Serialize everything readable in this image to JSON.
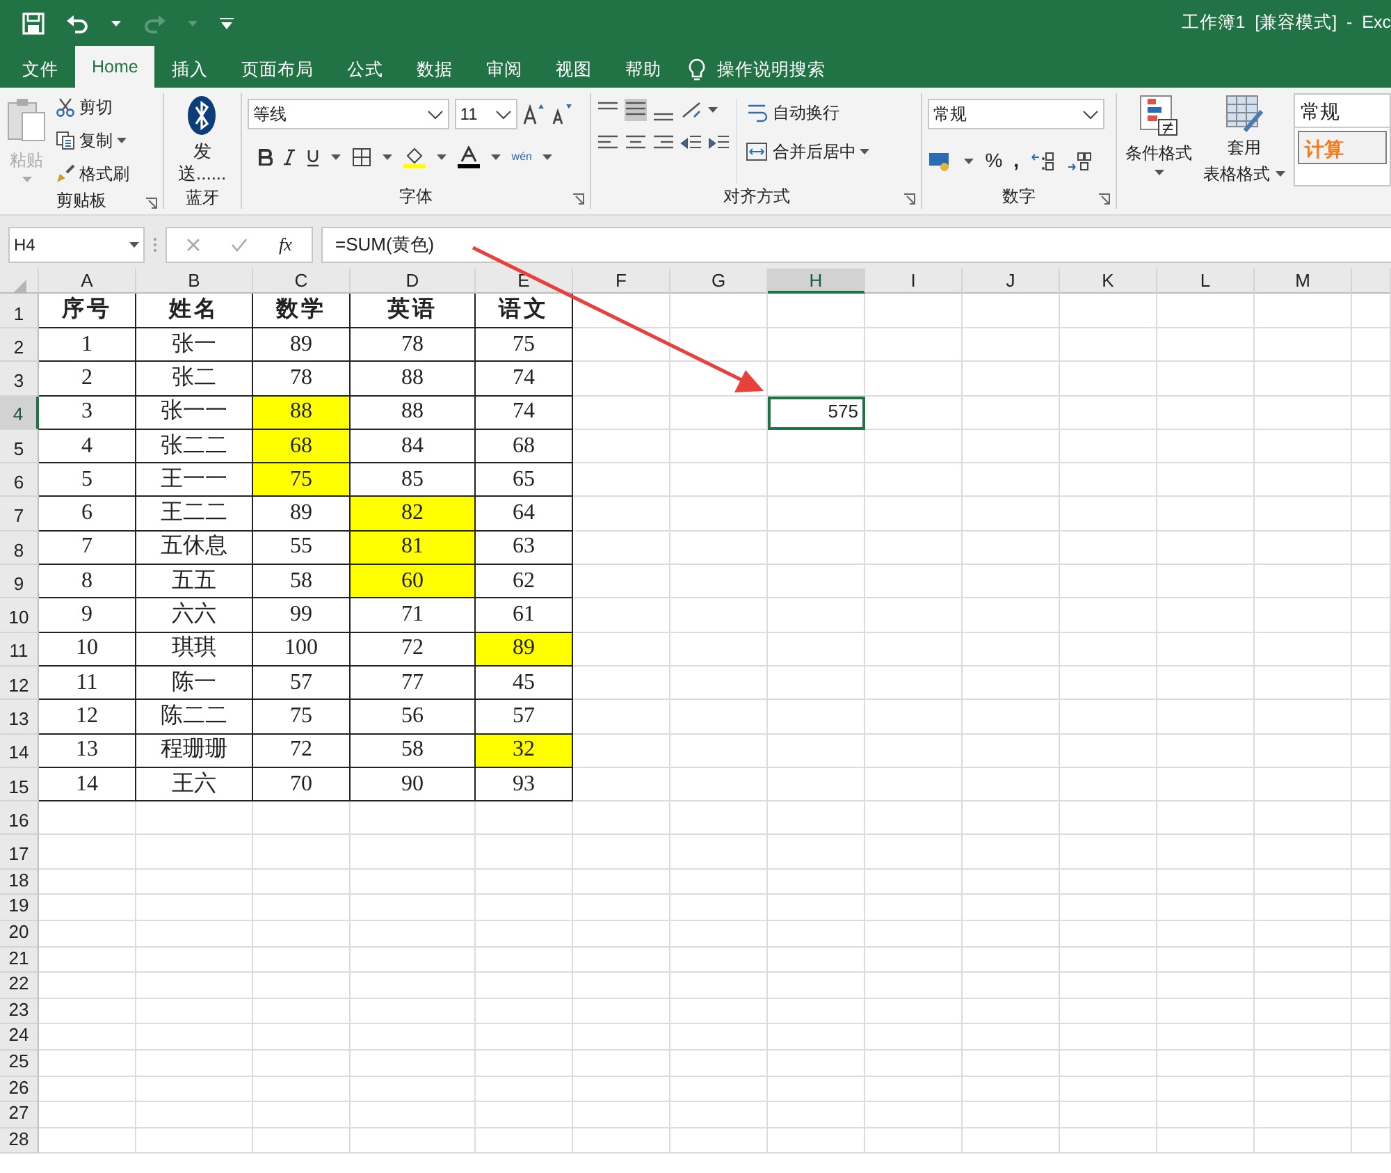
{
  "quick_access": {
    "redo_disabled": true
  },
  "window": {
    "title": "工作簿1  [兼容模式]  -  Exc"
  },
  "tabs": [
    {
      "label": "文件",
      "selected": false
    },
    {
      "label": "Home",
      "selected": true
    },
    {
      "label": "插入",
      "selected": false
    },
    {
      "label": "页面布局",
      "selected": false
    },
    {
      "label": "公式",
      "selected": false
    },
    {
      "label": "数据",
      "selected": false
    },
    {
      "label": "审阅",
      "selected": false
    },
    {
      "label": "视图",
      "selected": false
    },
    {
      "label": "帮助",
      "selected": false
    }
  ],
  "tell_me": {
    "label": "操作说明搜索"
  },
  "ribbon": {
    "clipboard": {
      "label": "剪贴板",
      "paste": {
        "text": "粘贴",
        "disabled": true
      },
      "cut": "剪切",
      "copy": "复制",
      "format_painter": "格式刷"
    },
    "bluetooth": {
      "label": "蓝牙",
      "send": "发送......"
    },
    "font": {
      "label": "字体",
      "font_name": "等线",
      "font_size": "11",
      "phonetic": "wén"
    },
    "alignment": {
      "label": "对齐方式",
      "wrap_text": "自动换行",
      "merge_center": "合并后居中"
    },
    "number": {
      "label": "数字",
      "format": "常规",
      "percent": "%",
      "comma": ","
    },
    "styles": {
      "conditional_formatting": "条件格式",
      "format_as_table_1": "套用",
      "format_as_table_2": "表格格式",
      "style_normal": "常规",
      "style_calculation": "计算"
    }
  },
  "formula_bar": {
    "name_box": "H4",
    "fx": "fx",
    "formula": "=SUM(黄色)"
  },
  "sheet": {
    "columns": [
      {
        "label": "A",
        "selected": false
      },
      {
        "label": "B",
        "selected": false
      },
      {
        "label": "C",
        "selected": false
      },
      {
        "label": "D",
        "selected": false
      },
      {
        "label": "E",
        "selected": false
      },
      {
        "label": "F",
        "selected": false
      },
      {
        "label": "G",
        "selected": false
      },
      {
        "label": "H",
        "selected": true
      },
      {
        "label": "I",
        "selected": false
      },
      {
        "label": "J",
        "selected": false
      },
      {
        "label": "K",
        "selected": false
      },
      {
        "label": "L",
        "selected": false
      },
      {
        "label": "M",
        "selected": false
      }
    ],
    "rows": [
      {
        "header": "1",
        "selected": false,
        "cells": [
          {
            "text": "序号",
            "highlighted": false
          },
          {
            "text": "姓名",
            "highlighted": false
          },
          {
            "text": "数学",
            "highlighted": false
          },
          {
            "text": "英语",
            "highlighted": false
          },
          {
            "text": "语文",
            "highlighted": false
          }
        ]
      },
      {
        "header": "2",
        "selected": false,
        "cells": [
          {
            "text": "1",
            "highlighted": false
          },
          {
            "text": "张一",
            "highlighted": false
          },
          {
            "text": "89",
            "highlighted": false
          },
          {
            "text": "78",
            "highlighted": false
          },
          {
            "text": "75",
            "highlighted": false
          }
        ]
      },
      {
        "header": "3",
        "selected": false,
        "cells": [
          {
            "text": "2",
            "highlighted": false
          },
          {
            "text": "张二",
            "highlighted": false
          },
          {
            "text": "78",
            "highlighted": false
          },
          {
            "text": "88",
            "highlighted": false
          },
          {
            "text": "74",
            "highlighted": false
          }
        ]
      },
      {
        "header": "4",
        "selected": true,
        "cells": [
          {
            "text": "3",
            "highlighted": false
          },
          {
            "text": "张一一",
            "highlighted": false
          },
          {
            "text": "88",
            "highlighted": true
          },
          {
            "text": "88",
            "highlighted": false
          },
          {
            "text": "74",
            "highlighted": false
          }
        ]
      },
      {
        "header": "5",
        "selected": false,
        "cells": [
          {
            "text": "4",
            "highlighted": false
          },
          {
            "text": "张二二",
            "highlighted": false
          },
          {
            "text": "68",
            "highlighted": true
          },
          {
            "text": "84",
            "highlighted": false
          },
          {
            "text": "68",
            "highlighted": false
          }
        ]
      },
      {
        "header": "6",
        "selected": false,
        "cells": [
          {
            "text": "5",
            "highlighted": false
          },
          {
            "text": "王一一",
            "highlighted": false
          },
          {
            "text": "75",
            "highlighted": true
          },
          {
            "text": "85",
            "highlighted": false
          },
          {
            "text": "65",
            "highlighted": false
          }
        ]
      },
      {
        "header": "7",
        "selected": false,
        "cells": [
          {
            "text": "6",
            "highlighted": false
          },
          {
            "text": "王二二",
            "highlighted": false
          },
          {
            "text": "89",
            "highlighted": false
          },
          {
            "text": "82",
            "highlighted": true
          },
          {
            "text": "64",
            "highlighted": false
          }
        ]
      },
      {
        "header": "8",
        "selected": false,
        "cells": [
          {
            "text": "7",
            "highlighted": false
          },
          {
            "text": "五休息",
            "highlighted": false
          },
          {
            "text": "55",
            "highlighted": false
          },
          {
            "text": "81",
            "highlighted": true
          },
          {
            "text": "63",
            "highlighted": false
          }
        ]
      },
      {
        "header": "9",
        "selected": false,
        "cells": [
          {
            "text": "8",
            "highlighted": false
          },
          {
            "text": "五五",
            "highlighted": false
          },
          {
            "text": "58",
            "highlighted": false
          },
          {
            "text": "60",
            "highlighted": true
          },
          {
            "text": "62",
            "highlighted": false
          }
        ]
      },
      {
        "header": "10",
        "selected": false,
        "cells": [
          {
            "text": "9",
            "highlighted": false
          },
          {
            "text": "六六",
            "highlighted": false
          },
          {
            "text": "99",
            "highlighted": false
          },
          {
            "text": "71",
            "highlighted": false
          },
          {
            "text": "61",
            "highlighted": false
          }
        ]
      },
      {
        "header": "11",
        "selected": false,
        "cells": [
          {
            "text": "10",
            "highlighted": false
          },
          {
            "text": "琪琪",
            "highlighted": false
          },
          {
            "text": "100",
            "highlighted": false
          },
          {
            "text": "72",
            "highlighted": false
          },
          {
            "text": "89",
            "highlighted": true
          }
        ]
      },
      {
        "header": "12",
        "selected": false,
        "cells": [
          {
            "text": "11",
            "highlighted": false
          },
          {
            "text": "陈一",
            "highlighted": false
          },
          {
            "text": "57",
            "highlighted": false
          },
          {
            "text": "77",
            "highlighted": false
          },
          {
            "text": "45",
            "highlighted": false
          }
        ]
      },
      {
        "header": "13",
        "selected": false,
        "cells": [
          {
            "text": "12",
            "highlighted": false
          },
          {
            "text": "陈二二",
            "highlighted": false
          },
          {
            "text": "75",
            "highlighted": false
          },
          {
            "text": "56",
            "highlighted": false
          },
          {
            "text": "57",
            "highlighted": false
          }
        ]
      },
      {
        "header": "14",
        "selected": false,
        "cells": [
          {
            "text": "13",
            "highlighted": false
          },
          {
            "text": "程珊珊",
            "highlighted": false
          },
          {
            "text": "72",
            "highlighted": false
          },
          {
            "text": "58",
            "highlighted": false
          },
          {
            "text": "32",
            "highlighted": true
          }
        ]
      },
      {
        "header": "15",
        "selected": false,
        "cells": [
          {
            "text": "14",
            "highlighted": false
          },
          {
            "text": "王六",
            "highlighted": false
          },
          {
            "text": "70",
            "highlighted": false
          },
          {
            "text": "90",
            "highlighted": false
          },
          {
            "text": "93",
            "highlighted": false
          }
        ]
      },
      {
        "header": "16",
        "selected": false
      },
      {
        "header": "17",
        "selected": false
      },
      {
        "header": "18",
        "selected": false
      },
      {
        "header": "19",
        "selected": false
      },
      {
        "header": "20",
        "selected": false
      },
      {
        "header": "21",
        "selected": false
      },
      {
        "header": "22",
        "selected": false
      },
      {
        "header": "23",
        "selected": false
      },
      {
        "header": "24",
        "selected": false
      },
      {
        "header": "25",
        "selected": false
      },
      {
        "header": "26",
        "selected": false
      },
      {
        "header": "27",
        "selected": false
      },
      {
        "header": "28",
        "selected": false
      }
    ],
    "active_cell": {
      "text": "575"
    }
  }
}
